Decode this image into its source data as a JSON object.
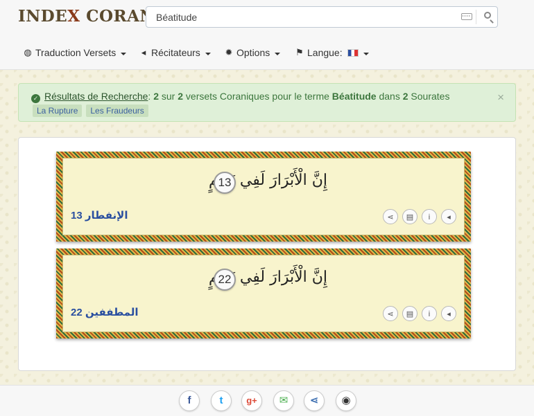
{
  "header": {
    "logo": {
      "part1": "INDE",
      "x": "X",
      "part2": " CORAN"
    },
    "search": {
      "value": "Béatitude",
      "placeholder": ""
    }
  },
  "nav": {
    "translation": {
      "label": "Traduction Versets",
      "icon": "globe-icon"
    },
    "reciters": {
      "label": "Récitateurs",
      "icon": "volume-icon"
    },
    "options": {
      "label": "Options",
      "icon": "gear-icon"
    },
    "language": {
      "label": "Langue:",
      "icon": "flag-icon",
      "flag": "fr"
    }
  },
  "alert": {
    "link": "Résultats de Recherche",
    "colon": ":",
    "count": "2",
    "sur": " sur ",
    "total": "2",
    "text1": " versets Coraniques pour le terme ",
    "term": "Béatitude",
    "text2": " dans ",
    "surah_count": "2",
    "text3": " Sourates",
    "close": "×",
    "tags": [
      "La Rupture",
      "Les Fraudeurs"
    ]
  },
  "verses": [
    {
      "arabic": "إِنَّ الْأَبْرَارَ لَفِي نَعِيمٍ",
      "number": "13",
      "reference": "الإنفطار 13"
    },
    {
      "arabic": "إِنَّ الْأَبْرَارَ لَفِي نَعِيمٍ",
      "number": "22",
      "reference": "المطففين 22"
    }
  ],
  "colors": {
    "accent": "#2a4fa0",
    "alert_bg": "#dff0d8",
    "alert_text": "#3c763d",
    "facebook": "#3b5998",
    "twitter": "#1da1f2",
    "google": "#dd4b39",
    "email": "#4caf50",
    "share": "#3b6db0",
    "github": "#333333"
  },
  "footer": {
    "icons": [
      "facebook-icon",
      "twitter-icon",
      "google-plus-icon",
      "email-icon",
      "share-icon",
      "github-icon"
    ]
  }
}
